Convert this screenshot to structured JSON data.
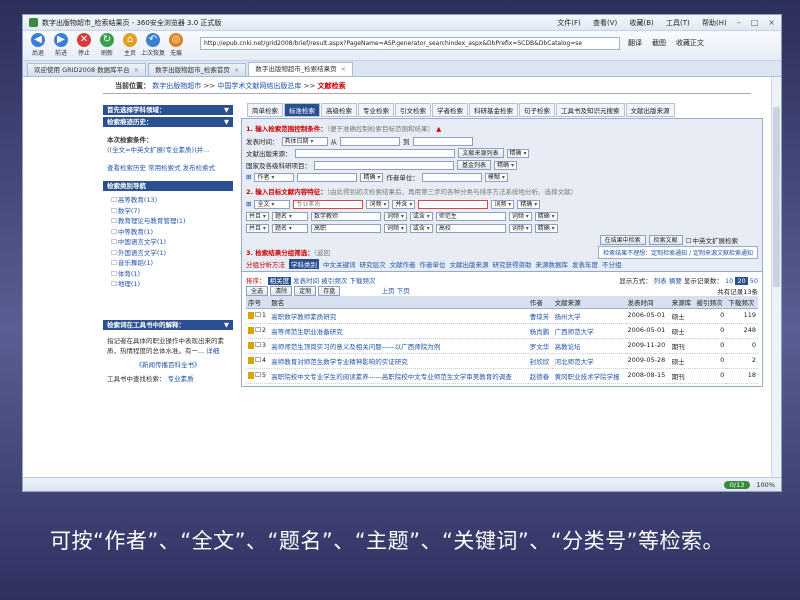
{
  "browser": {
    "title": "数字出版物超市_检索结果页 - 360安全浏览器 3.0 正式版",
    "menu": [
      "文件(F)",
      "查看(V)",
      "收藏(B)",
      "工具(T)",
      "帮助(H)"
    ],
    "window_controls": [
      "–",
      "□",
      "×"
    ],
    "nav_buttons": [
      {
        "label": "后退",
        "icon": "back-icon",
        "color": "#3a7fd0"
      },
      {
        "label": "前进",
        "icon": "forward-icon",
        "color": "#3a7fd0"
      },
      {
        "label": "停止",
        "icon": "stop-icon",
        "color": "#d93a3a"
      },
      {
        "label": "刷新",
        "icon": "refresh-icon",
        "color": "#3aa04a"
      },
      {
        "label": "主页",
        "icon": "home-icon",
        "color": "#e0a020"
      },
      {
        "label": "上次恢复",
        "icon": "restore-icon",
        "color": "#3a7fd0"
      },
      {
        "label": "无痕",
        "icon": "incognito-icon",
        "color": "#e08020"
      }
    ],
    "address_prefix": "http://",
    "address": "epub.cnki.net/grid2008/brief/result.aspx?PageName=ASP.generator_searchindex_aspx&DbPrefix=SCDB&DbCatalog=se",
    "right_tools": [
      "翻译",
      "截图",
      "收藏正文"
    ],
    "tabs": [
      {
        "label": "欢迎使用 GRID2008 数据库平台",
        "active": false
      },
      {
        "label": "数字出版物超市_检索首页",
        "active": false
      },
      {
        "label": "数字出版物超市_检索结果页",
        "active": true
      }
    ],
    "status": {
      "badge": "0/13",
      "zoom": "100%"
    }
  },
  "breadcrumb": {
    "label": "当前位置：",
    "parts": [
      "数字出版物超市",
      "中国学术文献网络出版总库"
    ],
    "separator": ">>",
    "current": "文献检索"
  },
  "sidebar": {
    "headers": {
      "first_discipline": "首先选择学科领域：",
      "history": "检索痕迹历史：",
      "category_nav": "检索类别导航",
      "keyword_help": "检索词在工具书中的解释："
    },
    "condition_label": "本次检索条件：",
    "condition_text": "((全文=中英文扩展(专业素质))并...",
    "history_links": [
      "查看检索历史",
      "常用检索式",
      "发布检索式"
    ],
    "categories": [
      "高等教育(13)",
      "数学(7)",
      "教育理论与教育管理(1)",
      "中等教育(1)",
      "中国语言文学(1)",
      "外国语言文学(1)",
      "音乐舞蹈(1)",
      "体育(1)",
      "地理(1)"
    ],
    "keyword_desc": "指记者在具体的职业操作中表现出来的素质，热情程度的总体水准。有一...",
    "keyword_more": "详细",
    "book_link": "《新闻传播百科全书》",
    "book_label": "工具书中查找检索：",
    "book_term": "专业素质"
  },
  "search_tabs": [
    "简单检索",
    "标准检索",
    "高级检索",
    "专业检索",
    "引文检索",
    "学者检索",
    "科研基金检索",
    "句子检索",
    "工具书及知识元搜索",
    "文献出版来源"
  ],
  "active_search_tab": "标准检索",
  "section1": {
    "title": "1. 输入检索范围控制条件：",
    "note": "（便于准确控制检索目标范围和结果）",
    "date_label": "发表时间：",
    "date_from_sel": "具体日期",
    "date_from_text": "从",
    "date_to_text": "到",
    "source_label": "文献出版来源：",
    "source_btn": "文献来源列表",
    "source_match": "精确",
    "fund_label": "国家及各级科研项目：",
    "fund_btn": "基金列表",
    "fund_match": "精确",
    "author_sel": "作者",
    "author_match": "精确",
    "author_unit_label": "作者单位：",
    "author_unit_match": "模糊"
  },
  "section2": {
    "title": "2. 输入目标文献内容特征：",
    "note": "（由此得到初次检索结果后，再用第三步的各种分类与排序方法系统地分析、选择文献）",
    "rows": [
      {
        "logic": "",
        "field": "全文",
        "value": "专业素质",
        "freq": "词频",
        "op": "并含",
        "value2": "",
        "freq2": "词频",
        "match": "精确"
      },
      {
        "logic": "并且",
        "field": "题名",
        "value": "数学教师",
        "freq": "词频",
        "op": "或含",
        "value2": "师范生",
        "freq2": "词频",
        "match": "精确"
      },
      {
        "logic": "并且",
        "field": "题名",
        "value": "高职",
        "freq": "词频",
        "op": "或含",
        "value2": "高校",
        "freq2": "词频",
        "match": "精确"
      }
    ],
    "btn_in_results": "在结果中检索",
    "btn_search": "检索文献",
    "ext_label": "中英文扩展检索"
  },
  "section3": {
    "title": "3. 检索结果分组筛选：",
    "note": "（返回",
    "hint_text": "检索结果不理想：定制检索通知 / 定制来源文献检索通知",
    "group_label": "分组分析方法",
    "groups": [
      "学科类别",
      "中文关键词",
      "研究层次",
      "文献作者",
      "作者单位",
      "文献出版来源",
      "研究获得资助",
      "来源数据库",
      "发表年度",
      "不分组"
    ],
    "sort_label": "排序：",
    "sorts": [
      "相关度",
      "发表时间",
      "被引频次",
      "下载频次"
    ],
    "show_label": "显示方式：",
    "show_options": [
      "列表",
      "摘要"
    ],
    "page_size_label": "显示记录数：",
    "page_sizes": [
      "10",
      "20",
      "50"
    ],
    "actions": [
      "全选",
      "清除",
      "定制",
      "存盘"
    ],
    "pager": [
      "上页",
      "下页"
    ],
    "total_label": "共有记录13条",
    "columns": [
      "序号",
      "题名",
      "作者",
      "文献来源",
      "发表时间",
      "来源库",
      "被引频次",
      "下载频次"
    ],
    "results": [
      {
        "no": "1",
        "title": "高职数学教师素质研究",
        "author": "曹琼芳",
        "source": "扬州大学",
        "date": "2006-05-01",
        "db": "硕士",
        "cited": "0",
        "downloads": "119"
      },
      {
        "no": "2",
        "title": "高等师范生职业准备研究",
        "author": "杨肖鹏",
        "source": "广西师范大学",
        "date": "2006-05-01",
        "db": "硕士",
        "cited": "0",
        "downloads": "248"
      },
      {
        "no": "3",
        "title": "高师师范生顶岗实习的意义及相关问题——以广西师院为例",
        "author": "罗文华",
        "source": "高教论坛",
        "date": "2009-11-20",
        "db": "期刊",
        "cited": "0",
        "downloads": "0"
      },
      {
        "no": "4",
        "title": "高师教育对师范生数学专业精神影响的实证研究",
        "author": "封欣欣",
        "source": "河北师范大学",
        "date": "2009-05-28",
        "db": "硕士",
        "cited": "0",
        "downloads": "2"
      },
      {
        "no": "5",
        "title": "高职院校中文专业学生的阅读素养——高职院校中文专业师范生文学审美教育的调查",
        "author": "赵德春",
        "source": "黄冈职业技术学院学报",
        "date": "2008-08-15",
        "db": "期刊",
        "cited": "0",
        "downloads": "18"
      }
    ]
  },
  "caption": "可按“作者”、“全文”、“题名”、“主题”、“关键词”、“分类号”等检索。"
}
